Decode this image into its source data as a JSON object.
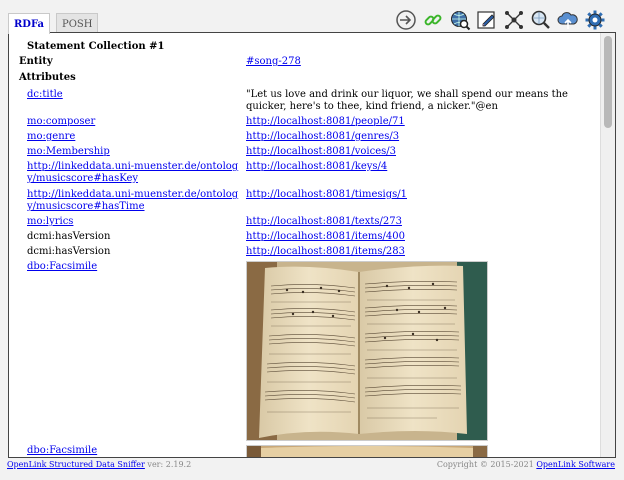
{
  "tabs": {
    "active": "RDFa",
    "inactive": "POSH"
  },
  "toolbar": {
    "icons": [
      "login-icon",
      "link-icon",
      "globe-search-icon",
      "edit-icon",
      "network-icon",
      "search-icon",
      "cloud-upload-icon",
      "gear-icon"
    ]
  },
  "collection": {
    "title": "Statement Collection #1",
    "entity_label": "Entity",
    "entity_value": "#song-278",
    "attributes_label": "Attributes"
  },
  "attributes": [
    {
      "pred": "dc:title",
      "pred_link": true,
      "obj": "\"Let us love and drink our liquor, we shall spend our means the quicker, here's to thee, kind friend, a nicker.\"@en",
      "obj_link": false
    },
    {
      "pred": "mo:composer",
      "pred_link": true,
      "obj": "http://localhost:8081/people/71",
      "obj_link": true
    },
    {
      "pred": "mo:genre",
      "pred_link": true,
      "obj": "http://localhost:8081/genres/3",
      "obj_link": true
    },
    {
      "pred": "mo:Membership",
      "pred_link": true,
      "obj": "http://localhost:8081/voices/3",
      "obj_link": true
    },
    {
      "pred": "http://linkeddata.uni-muenster.de/ontology/musicscore#hasKey",
      "pred_link": true,
      "obj": "http://localhost:8081/keys/4",
      "obj_link": true
    },
    {
      "pred": "http://linkeddata.uni-muenster.de/ontology/musicscore#hasTime",
      "pred_link": true,
      "obj": "http://localhost:8081/timesigs/1",
      "obj_link": true
    },
    {
      "pred": "mo:lyrics",
      "pred_link": true,
      "obj": "http://localhost:8081/texts/273",
      "obj_link": true
    },
    {
      "pred": "dcmi:hasVersion",
      "pred_link": false,
      "obj": "http://localhost:8081/items/400",
      "obj_link": true
    },
    {
      "pred": "dcmi:hasVersion",
      "pred_link": false,
      "obj": "http://localhost:8081/items/283",
      "obj_link": true
    },
    {
      "pred": "dbo:Facsimile",
      "pred_link": true,
      "obj": "",
      "obj_link": false
    },
    {
      "pred": "dbo:Facsimile",
      "pred_link": true,
      "obj": "",
      "obj_link": false
    }
  ],
  "footer": {
    "app_link": "OpenLink Structured Data Sniffer",
    "version": "ver: 2.19.2",
    "copyright": "Copyright © 2015-2021",
    "company_link": "OpenLink Software"
  }
}
